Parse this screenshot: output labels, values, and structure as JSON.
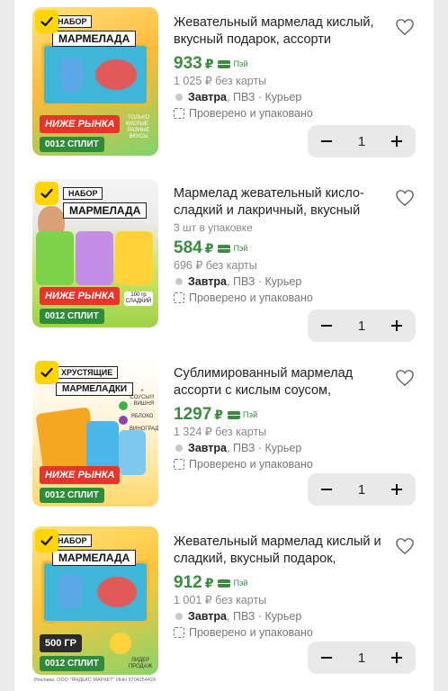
{
  "items": [
    {
      "title": "Жевательный мармелад кислый, вкусный подарок, ассорти разных…",
      "sub": "",
      "price": "933",
      "currency": "₽",
      "pay_label": "Пэй",
      "old_price": "1 025 ₽ без карты",
      "delivery_day": "Завтра",
      "delivery_rest": ", ПВЗ · Курьер",
      "checked_text": "Проверено и упаковано",
      "qty": "1",
      "poster": {
        "l1": "НАБОР",
        "l2": "МАРМЕЛАДА",
        "ribbon": "НИЖЕ РЫНКА",
        "split": "0012 СПЛИТ",
        "side": "ТОЛЬКО КИСЛЫЕ · РАЗНЫЕ ВКУСЫ"
      }
    },
    {
      "title": "Мармелад жевательный кисло-сладкий и лакричный, вкусный по…",
      "sub": "3 шт в упаковке",
      "price": "584",
      "currency": "₽",
      "pay_label": "Пэй",
      "old_price": "696 ₽ без карты",
      "delivery_day": "Завтра",
      "delivery_rest": ", ПВЗ · Курьер",
      "checked_text": "Проверено и упаковано",
      "qty": "1",
      "poster": {
        "l1": "НАБОР",
        "l2": "МАРМЕЛАДА",
        "ribbon": "НИЖЕ РЫНКА",
        "split": "0012 СПЛИТ",
        "side": "100 гр СЛАДКИЙ"
      }
    },
    {
      "title": "Сублимированный мармелад ассорти с кислым соусом, персик…",
      "sub": "",
      "price": "1297",
      "currency": "₽",
      "pay_label": "Пэй",
      "old_price": "1 324 ₽ без карты",
      "delivery_day": "Завтра",
      "delivery_rest": ", ПВЗ · Курьер",
      "checked_text": "Проверено и упаковано",
      "qty": "1",
      "poster": {
        "l1": "ХРУСТЯЩИЕ",
        "l2": "МАРМЕЛАДКИ",
        "ribbon": "НИЖЕ РЫНКА",
        "split": "0012 СПЛИТ",
        "side": "+ СОУСЫ!!! · ВИШНЯ · ЯБЛОКО · ВИНОГРАД"
      }
    },
    {
      "title": "Жевательный мармелад кислый и сладкий, вкусный подарок, ассорт…",
      "sub": "",
      "price": "912",
      "currency": "₽",
      "pay_label": "Пэй",
      "old_price": "1 001 ₽ без карты",
      "delivery_day": "Завтра",
      "delivery_rest": ", ПВЗ · Курьер",
      "checked_text": "Проверено и упаковано",
      "qty": "1",
      "poster": {
        "l1": "НАБОР",
        "l2": "МАРМЕЛАДА",
        "ribbon": "500 ГР",
        "split": "0012 СПЛИТ",
        "side": "ЛИДЕР ПРОДАЖ"
      }
    }
  ],
  "ad_text": "Реклама. ООО \"ЯНДЕКС МАРКЕТ\" ИНН 9704254424",
  "colors": {
    "accent_green": "#3a8c3f",
    "check_yellow": "#ffd500",
    "ribbon_red": "#e8352c"
  }
}
